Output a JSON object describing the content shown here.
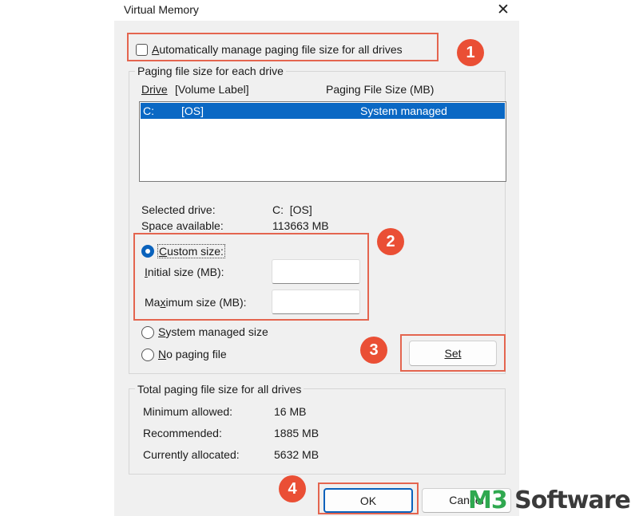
{
  "window": {
    "title": "Virtual Memory",
    "close_glyph": "✕"
  },
  "auto_manage": {
    "label": "Automatically manage paging file size for all drives",
    "checked": false
  },
  "paging_group": {
    "legend": "Paging file size for each drive",
    "columns": {
      "drive": "Drive",
      "volume_label": "[Volume Label]",
      "size": "Paging File Size (MB)"
    },
    "rows": [
      {
        "drive": "C:",
        "label": "[OS]",
        "size": "System managed",
        "selected": true
      }
    ],
    "selected_drive": {
      "label": "Selected drive:",
      "value": "C:  [OS]"
    },
    "space_available": {
      "label": "Space available:",
      "value": "113663 MB"
    },
    "options": {
      "custom_size": {
        "label": "Custom size:",
        "checked": true
      },
      "initial_size": {
        "label": "Initial size (MB):",
        "value": ""
      },
      "maximum_size": {
        "label": "Maximum size (MB):",
        "value": ""
      },
      "system_managed": {
        "label": "System managed size",
        "checked": false
      },
      "no_paging": {
        "label": "No paging file",
        "checked": false
      }
    },
    "set_button": "Set"
  },
  "totals_group": {
    "legend": "Total paging file size for all drives",
    "minimum": {
      "label": "Minimum allowed:",
      "value": "16 MB"
    },
    "recommended": {
      "label": "Recommended:",
      "value": "1885 MB"
    },
    "allocated": {
      "label": "Currently allocated:",
      "value": "5632 MB"
    }
  },
  "buttons": {
    "ok": "OK",
    "cancel": "Cancel"
  },
  "annotations": [
    "1",
    "2",
    "3",
    "4"
  ],
  "watermark": {
    "prefix": "M3",
    "suffix": " Software"
  },
  "colors": {
    "accent": "#0a62bc",
    "annotation": "#ea4f35",
    "watermark_green": "#2fa84f"
  }
}
